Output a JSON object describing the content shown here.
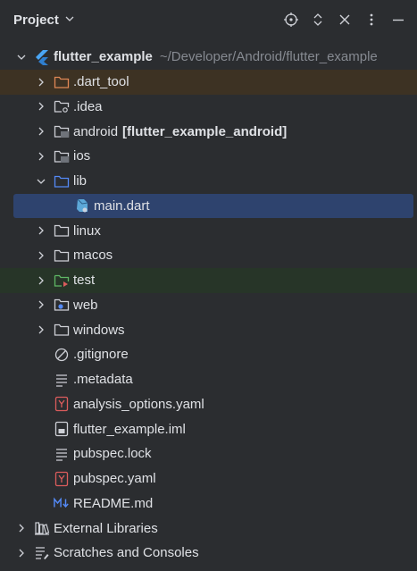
{
  "panel": {
    "title": "Project",
    "toolbar": [
      {
        "name": "locate-file-icon"
      },
      {
        "name": "expand-collapse-icon"
      },
      {
        "name": "close-icon"
      },
      {
        "name": "more-options-icon"
      },
      {
        "name": "minimize-icon"
      }
    ]
  },
  "tree": {
    "root": {
      "label": "flutter_example",
      "path": "~/Developer/Android/flutter_example"
    },
    "items": [
      {
        "label": ".dart_tool",
        "icon": "excluded-folder-icon"
      },
      {
        "label": ".idea",
        "icon": "settings-folder-icon"
      },
      {
        "label": "android",
        "module": "[flutter_example_android]",
        "icon": "module-folder-icon"
      },
      {
        "label": "ios",
        "icon": "module-folder-icon"
      },
      {
        "label": "lib",
        "icon": "source-folder-icon"
      },
      {
        "label": "main.dart",
        "icon": "dart-file-icon"
      },
      {
        "label": "linux",
        "icon": "folder-icon"
      },
      {
        "label": "macos",
        "icon": "folder-icon"
      },
      {
        "label": "test",
        "icon": "test-folder-icon"
      },
      {
        "label": "web",
        "icon": "web-folder-icon"
      },
      {
        "label": "windows",
        "icon": "folder-icon"
      },
      {
        "label": ".gitignore",
        "icon": "ignore-file-icon"
      },
      {
        "label": ".metadata",
        "icon": "text-file-icon"
      },
      {
        "label": "analysis_options.yaml",
        "icon": "yaml-file-icon"
      },
      {
        "label": "flutter_example.iml",
        "icon": "iml-file-icon"
      },
      {
        "label": "pubspec.lock",
        "icon": "text-file-icon"
      },
      {
        "label": "pubspec.yaml",
        "icon": "yaml-file-icon"
      },
      {
        "label": "README.md",
        "icon": "markdown-file-icon"
      }
    ],
    "external_libraries": "External Libraries",
    "scratches": "Scratches and Consoles"
  },
  "colors": {
    "background": "#2b2d30",
    "selection": "#2e436e",
    "excluded_row": "#3d3223",
    "test_row": "#273528",
    "folder_stroke": "#ced0d6",
    "excluded_folder": "#e08855",
    "source_folder": "#548af7",
    "test_folder": "#5fb865",
    "yaml_red": "#db5c5c",
    "path_gray": "#868a91"
  }
}
